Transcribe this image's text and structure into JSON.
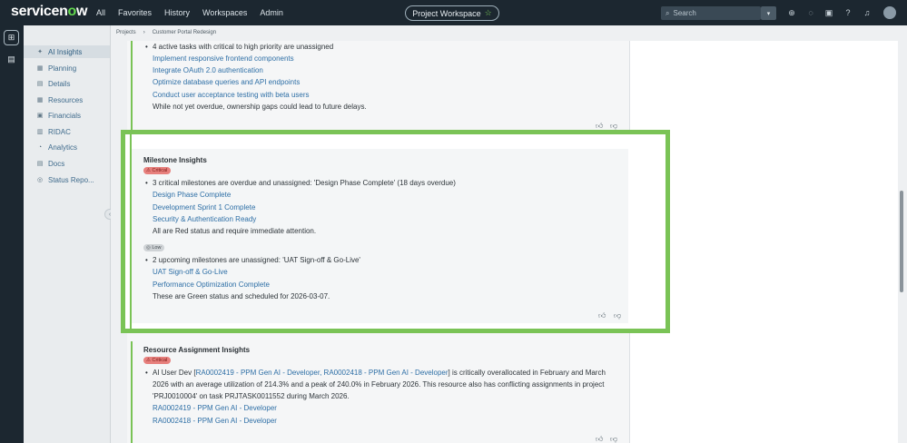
{
  "header": {
    "logo": "servicenow",
    "nav": [
      "All",
      "Favorites",
      "History",
      "Workspaces",
      "Admin"
    ],
    "workspace_button": "Project Workspace",
    "search_placeholder": "Search"
  },
  "breadcrumb": {
    "root": "Projects",
    "current": "Customer Portal Redesign"
  },
  "sidebar": {
    "items": [
      {
        "label": "AI Insights",
        "icon": "sparkle-icon"
      },
      {
        "label": "Planning",
        "icon": "planning-icon"
      },
      {
        "label": "Details",
        "icon": "details-icon"
      },
      {
        "label": "Resources",
        "icon": "resources-icon"
      },
      {
        "label": "Financials",
        "icon": "financials-icon"
      },
      {
        "label": "RIDAC",
        "icon": "ridac-icon"
      },
      {
        "label": "Analytics",
        "icon": "analytics-icon"
      },
      {
        "label": "Docs",
        "icon": "docs-icon"
      },
      {
        "label": "Status Repo...",
        "icon": "status-report-icon"
      }
    ]
  },
  "task_insights": {
    "bullet": "4 active tasks with critical to high priority are unassigned",
    "links": [
      "Implement responsive frontend components",
      "Integrate OAuth 2.0 authentication",
      "Optimize database queries and API endpoints",
      "Conduct user acceptance testing with beta users"
    ],
    "note": "While not yet overdue, ownership gaps could lead to future delays."
  },
  "milestone_insights": {
    "title": "Milestone Insights",
    "critical_badge": "Critical",
    "critical_bullet": "3 critical milestones are overdue and unassigned: 'Design Phase Complete' (18 days overdue)",
    "critical_links": [
      "Design Phase Complete",
      "Development Sprint 1 Complete",
      "Security & Authentication Ready"
    ],
    "critical_note": "All are Red status and require immediate attention.",
    "low_badge": "Low",
    "low_bullet": "2 upcoming milestones are unassigned: 'UAT Sign-off & Go-Live'",
    "low_links": [
      "UAT Sign-off & Go-Live",
      "Performance Optimization Complete"
    ],
    "low_note": "These are Green status and scheduled for 2026-03-07."
  },
  "resource_insights": {
    "title": "Resource Assignment Insights",
    "badge": "Critical",
    "line1_prefix": "AI User Dev [",
    "line1_link": "RA0002419 - PPM Gen AI - Developer, RA0002418 - PPM Gen AI - Developer",
    "line1_suffix": "] is critically overallocated in February and March",
    "line2": "2026 with an average utilization of 214.3% and a peak of 240.0% in February 2026. This resource also has conflicting assignments in project",
    "line3": "'PRJ0010004' on task PRJTASK0011552 during March 2026.",
    "links": [
      "RA0002419 - PPM Gen AI - Developer",
      "RA0002418 - PPM Gen AI - Developer"
    ]
  },
  "colors": {
    "accent": "#7ac356",
    "link": "#2e6fa6",
    "critical": "#e7807d"
  }
}
